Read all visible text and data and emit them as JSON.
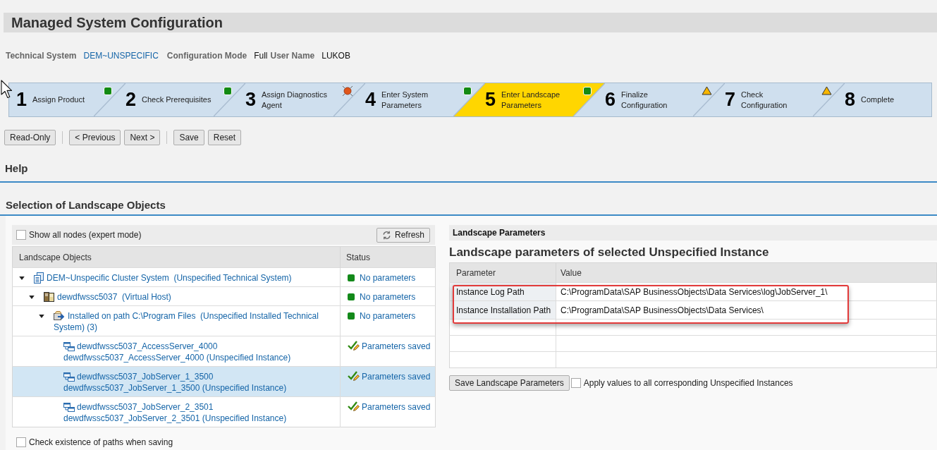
{
  "page": {
    "title": "Managed System Configuration"
  },
  "info": [
    {
      "label": "Technical System",
      "value": "DEM~UNSPECIFIC",
      "kind": "link"
    },
    {
      "label": "Configuration Mode",
      "value": "Full",
      "kind": "text"
    },
    {
      "label": "User Name",
      "value": "LUKOB",
      "kind": "text"
    }
  ],
  "wizard": [
    {
      "number": "1",
      "lines": [
        "Assign Product"
      ],
      "status": {
        "kind": "ok"
      },
      "selected": false
    },
    {
      "number": "2",
      "lines": [
        "Check Prerequisites"
      ],
      "status": {
        "kind": "ok"
      },
      "selected": false
    },
    {
      "number": "3",
      "lines": [
        "Assign Diagnostics",
        "Agent"
      ],
      "status": {
        "kind": "error"
      },
      "selected": false
    },
    {
      "number": "4",
      "lines": [
        "Enter System",
        "Parameters"
      ],
      "status": {
        "kind": "ok"
      },
      "selected": false
    },
    {
      "number": "5",
      "lines": [
        "Enter Landscape",
        "Parameters"
      ],
      "status": {
        "kind": "ok"
      },
      "selected": true
    },
    {
      "number": "6",
      "lines": [
        "Finalize",
        "Configuration"
      ],
      "status": {
        "kind": "warning"
      },
      "selected": false
    },
    {
      "number": "7",
      "lines": [
        "Check",
        "Configuration"
      ],
      "status": {
        "kind": "warning"
      },
      "selected": false
    },
    {
      "number": "8",
      "lines": [
        "Complete"
      ],
      "selected": false
    }
  ],
  "toolbar": [
    [
      "Read-Only"
    ],
    [
      "< Previous",
      "Next >"
    ],
    [
      "Save",
      "Reset"
    ]
  ],
  "help": {
    "title": "Help"
  },
  "selection": {
    "title": "Selection of Landscape Objects",
    "show_all": {
      "label": "Show all nodes (expert mode)",
      "checked": false
    },
    "refresh_button": "Refresh",
    "tree": {
      "columns": [
        "Landscape Objects",
        "Status"
      ],
      "nodes": [
        {
          "kind": "technical_system",
          "label": "DEM~Unspecific Cluster System  (Unspecified Technical System)",
          "expanded": true,
          "selected": false,
          "status": {
            "kind": "empty",
            "text": "No parameters"
          },
          "children": [
            {
              "kind": "host",
              "label": "dewdfwssc5037  (Virtual Host)",
              "expanded": true,
              "selected": false,
              "status": {
                "kind": "empty",
                "text": "No parameters"
              },
              "children": [
                {
                  "kind": "installation",
                  "label": "Installed on path C:\\Program Files  (Unspecified Installed Technical System) (3)",
                  "expanded": true,
                  "selected": false,
                  "status": {
                    "kind": "empty",
                    "text": "No parameters"
                  },
                  "children": [
                    {
                      "kind": "instance",
                      "label": "dewdfwssc5037_AccessServer_4000",
                      "description": "dewdfwssc5037_AccessServer_4000 (Unspecified Instance)",
                      "selected": false,
                      "status": {
                        "kind": "saved",
                        "text": "Parameters saved"
                      }
                    },
                    {
                      "kind": "instance",
                      "label": "dewdfwssc5037_JobServer_1_3500",
                      "description": "dewdfwssc5037_JobServer_1_3500 (Unspecified Instance)",
                      "selected": true,
                      "status": {
                        "kind": "saved",
                        "text": "Parameters saved"
                      }
                    },
                    {
                      "kind": "instance",
                      "label": "dewdfwssc5037_JobServer_2_3501",
                      "description": "dewdfwssc5037_JobServer_2_3501 (Unspecified Instance)",
                      "selected": false,
                      "status": {
                        "kind": "saved",
                        "text": "Parameters saved"
                      }
                    }
                  ]
                }
              ]
            }
          ]
        }
      ]
    },
    "check_paths": {
      "label": "Check existence of paths when saving",
      "checked": false
    }
  },
  "parameters": {
    "header": "Landscape Parameters",
    "title": "Landscape parameters of selected Unspecified Instance",
    "columns": [
      "Parameter",
      "Value"
    ],
    "rows": [
      {
        "parameter": "Instance Log Path",
        "value": "C:\\ProgramData\\SAP BusinessObjects\\Data Services\\log\\JobServer_1\\",
        "highlighted": true
      },
      {
        "parameter": "Instance Installation Path",
        "value": "C:\\ProgramData\\SAP BusinessObjects\\Data Services\\",
        "highlighted": true
      }
    ],
    "save_button": "Save Landscape Parameters",
    "apply_all": {
      "label": "Apply values to all corresponding Unspecified Instances",
      "checked": false
    }
  }
}
